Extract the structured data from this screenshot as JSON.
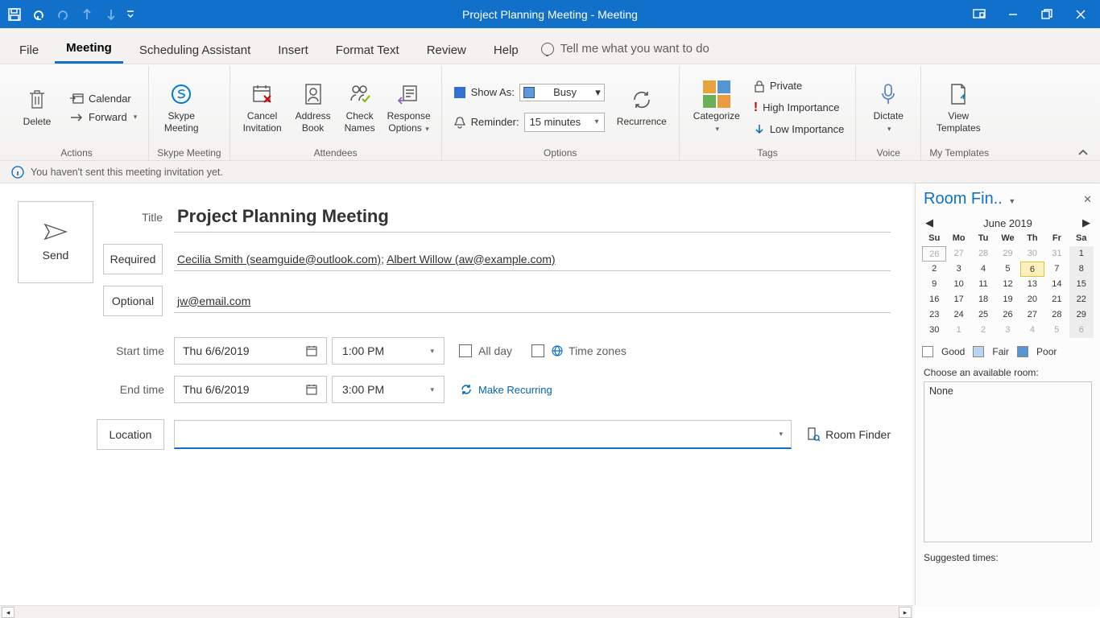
{
  "titlebar": {
    "title": "Project Planning Meeting  -  Meeting"
  },
  "tabs": {
    "file": "File",
    "meeting": "Meeting",
    "scheduling": "Scheduling Assistant",
    "insert": "Insert",
    "format": "Format Text",
    "review": "Review",
    "help": "Help",
    "tellme": "Tell me what you want to do"
  },
  "ribbon": {
    "delete": "Delete",
    "calendar": "Calendar",
    "forward": "Forward",
    "actions_grp": "Actions",
    "skype": "Skype Meeting",
    "skype_grp": "Skype Meeting",
    "cancel_inv": "Cancel Invitation",
    "addr_book": "Address Book",
    "check_names": "Check Names",
    "resp_opts": "Response Options",
    "attendees_grp": "Attendees",
    "show_as": "Show As:",
    "show_as_val": "Busy",
    "reminder": "Reminder:",
    "reminder_val": "15 minutes",
    "recurrence": "Recurrence",
    "options_grp": "Options",
    "categorize": "Categorize",
    "private": "Private",
    "hi_imp": "High Importance",
    "lo_imp": "Low Importance",
    "tags_grp": "Tags",
    "dictate": "Dictate",
    "voice_grp": "Voice",
    "view_tmpl": "View Templates",
    "tmpl_grp": "My Templates"
  },
  "infobar": "You haven't sent this meeting invitation yet.",
  "form": {
    "send": "Send",
    "title_lbl": "Title",
    "title_val": "Project Planning Meeting",
    "required_btn": "Required",
    "required_val1": "Cecilia Smith (seamguide@outlook.com)",
    "required_val2": "Albert Willow (aw@example.com)",
    "optional_btn": "Optional",
    "optional_val": "jw@email.com",
    "start_lbl": "Start time",
    "end_lbl": "End time",
    "start_date": "Thu 6/6/2019",
    "start_time": "1:00 PM",
    "end_date": "Thu 6/6/2019",
    "end_time": "3:00 PM",
    "all_day": "All day",
    "time_zones": "Time zones",
    "make_recurring": "Make Recurring",
    "location_btn": "Location",
    "room_finder": "Room Finder"
  },
  "pane": {
    "title": "Room Fin..",
    "month": "June 2019",
    "dayhead": [
      "Su",
      "Mo",
      "Tu",
      "We",
      "Th",
      "Fr",
      "Sa"
    ],
    "good": "Good",
    "fair": "Fair",
    "poor": "Poor",
    "choose": "Choose an available room:",
    "none": "None",
    "suggested": "Suggested times:"
  }
}
